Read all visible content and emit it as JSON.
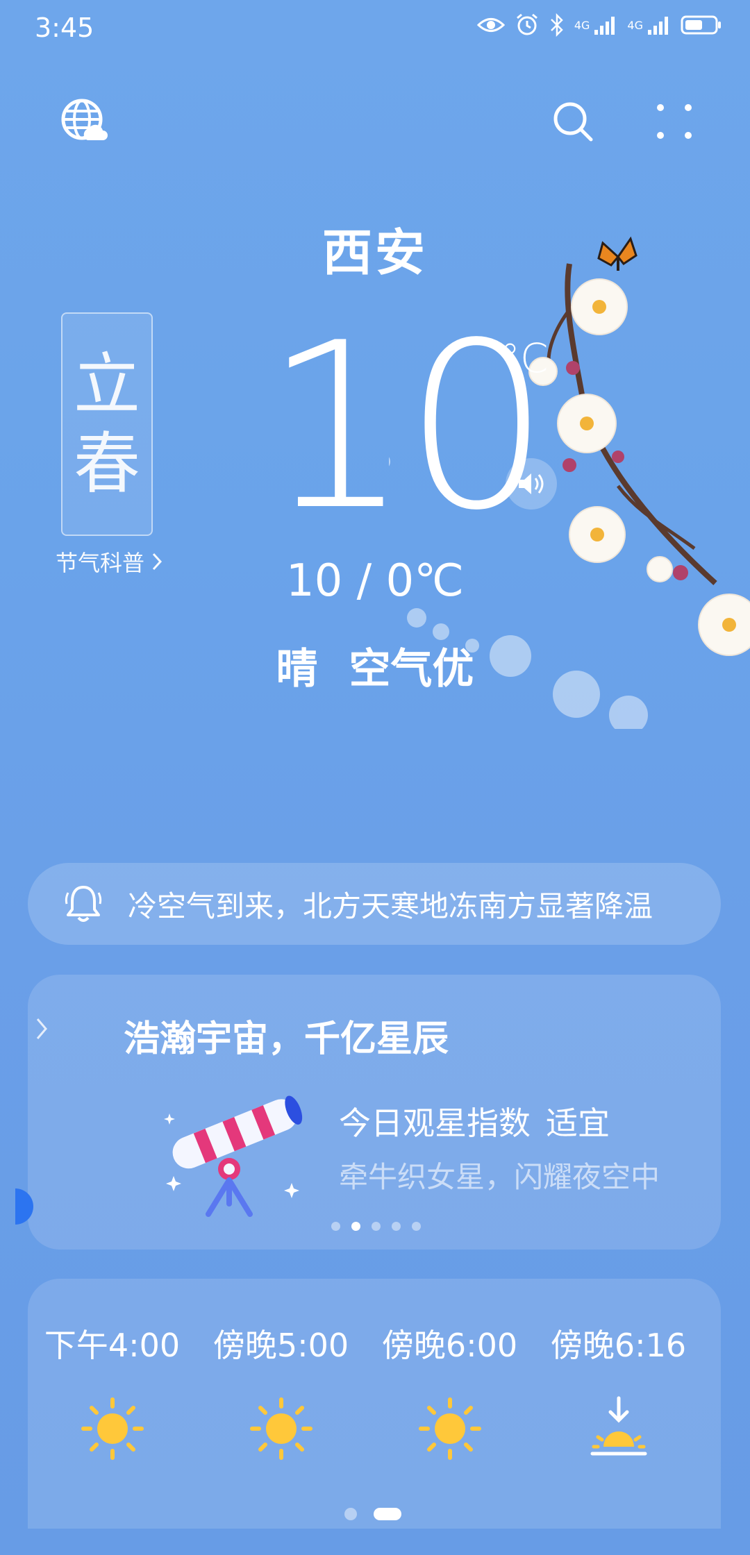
{
  "status_bar": {
    "time": "3:45",
    "network_1": "4G",
    "network_2": "4G"
  },
  "header": {
    "left_icon": "globe-cloud-icon",
    "search_icon": "search-icon",
    "menu_icon": "grid-dots-icon"
  },
  "weather": {
    "city": "西安",
    "temperature": "10",
    "unit": "°C",
    "range": "10 / 0℃",
    "condition": "晴",
    "air_quality": "空气优"
  },
  "solar_term": {
    "char1": "立",
    "char2": "春",
    "link_label": "节气科普"
  },
  "alert": {
    "text": "冷空气到来，北方天寒地冻南方显著降温"
  },
  "stargazing": {
    "title": "浩瀚宇宙，千亿星辰",
    "index_label": "今日观星指数",
    "index_value": "适宜",
    "subtitle": "牵牛织女星，闪耀夜空中",
    "page_count": 5,
    "active_page": 2
  },
  "hourly": [
    {
      "label": "下午4:00",
      "icon": "sun-icon"
    },
    {
      "label": "傍晚5:00",
      "icon": "sun-icon"
    },
    {
      "label": "傍晚6:00",
      "icon": "sun-icon"
    },
    {
      "label": "傍晚6:16",
      "icon": "sunset-icon"
    }
  ],
  "colors": {
    "background": "#6AA3EA",
    "sun": "#FFC83A",
    "accent_blue": "#2C74F0"
  }
}
